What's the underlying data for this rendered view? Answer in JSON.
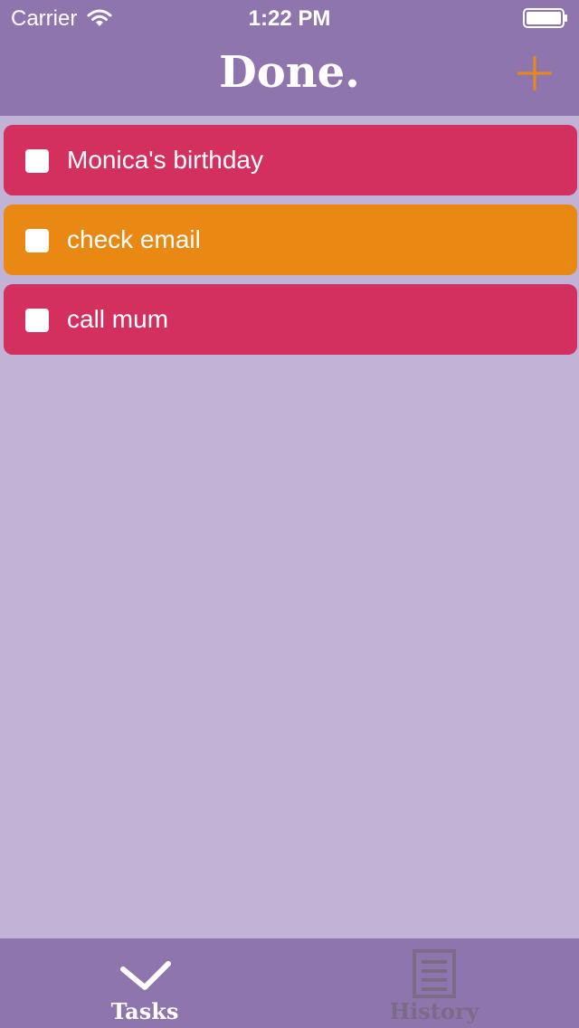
{
  "status_bar": {
    "carrier": "Carrier",
    "time": "1:22 PM"
  },
  "header": {
    "title": "Done.",
    "add_icon": "plus-icon"
  },
  "tasks": [
    {
      "label": "Monica's birthday",
      "color": "#d32f5f",
      "checked": false
    },
    {
      "label": "check email",
      "color": "#e98913",
      "checked": false
    },
    {
      "label": "call mum",
      "color": "#d32f5f",
      "checked": false
    }
  ],
  "tab_bar": {
    "tasks": {
      "label": "Tasks",
      "icon": "checkmark-icon",
      "active": true
    },
    "history": {
      "label": "History",
      "icon": "document-list-icon",
      "active": false
    }
  },
  "colors": {
    "header_bg": "#8f75ae",
    "page_bg": "#c1b3d5",
    "accent_orange": "#e98913",
    "task_red": "#d32f5f",
    "inactive_tab": "#7a6c85"
  }
}
